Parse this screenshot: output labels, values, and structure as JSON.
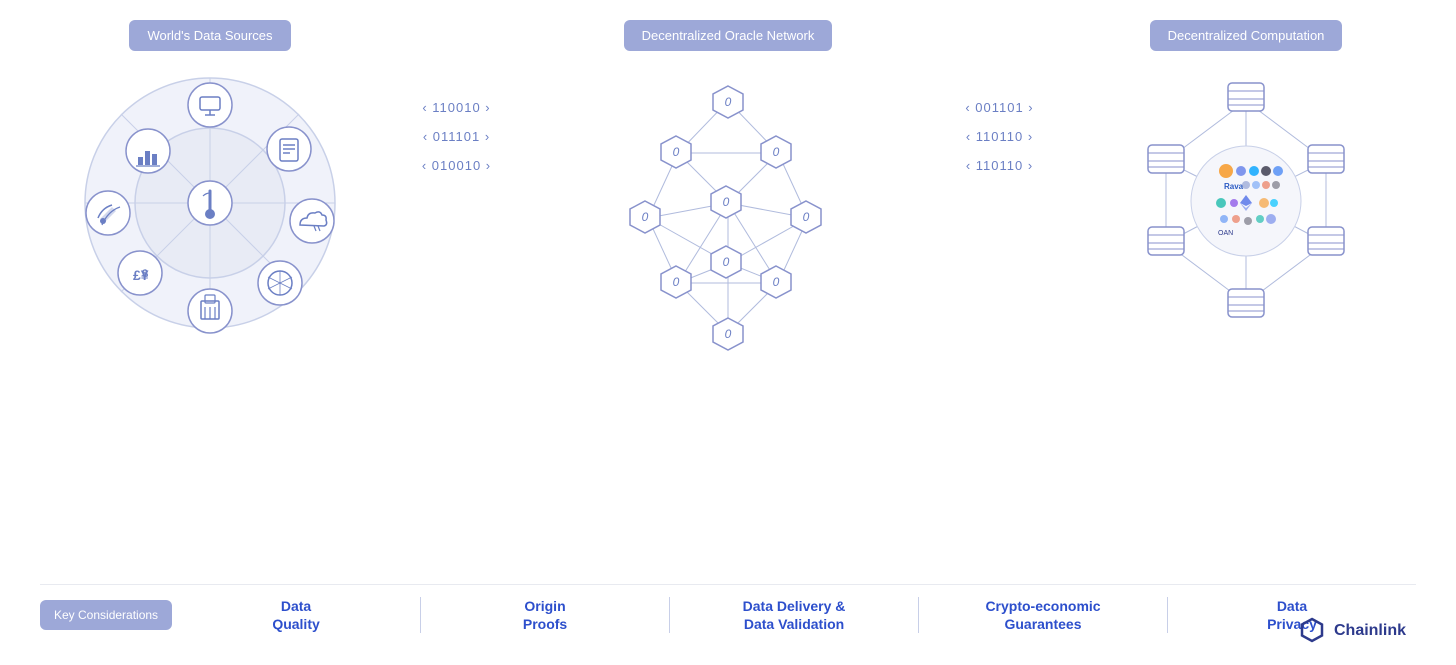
{
  "sections": {
    "left": {
      "badge": "World's Data Sources",
      "description": "Data sources diagram"
    },
    "middle": {
      "badge": "Decentralized Oracle Network",
      "description": "Oracle network diagram"
    },
    "right": {
      "badge": "Decentralized Computation",
      "description": "Computation diagram"
    }
  },
  "connectors": {
    "left_codes": [
      "‹ 110010 ›",
      "‹ 011101 ›",
      "‹ 010010 ›"
    ],
    "right_codes": [
      "‹ 001101 ›",
      "‹ 110110 ›",
      "‹ 110110 ›"
    ]
  },
  "bottom_bar": {
    "key_label": "Key Considerations",
    "items": [
      "Data\nQuality",
      "Origin\nProofs",
      "Data Delivery &\nData Validation",
      "Crypto-economic\nGuarantees",
      "Data\nPrivacy"
    ]
  },
  "brand": {
    "name": "Chainlink"
  }
}
